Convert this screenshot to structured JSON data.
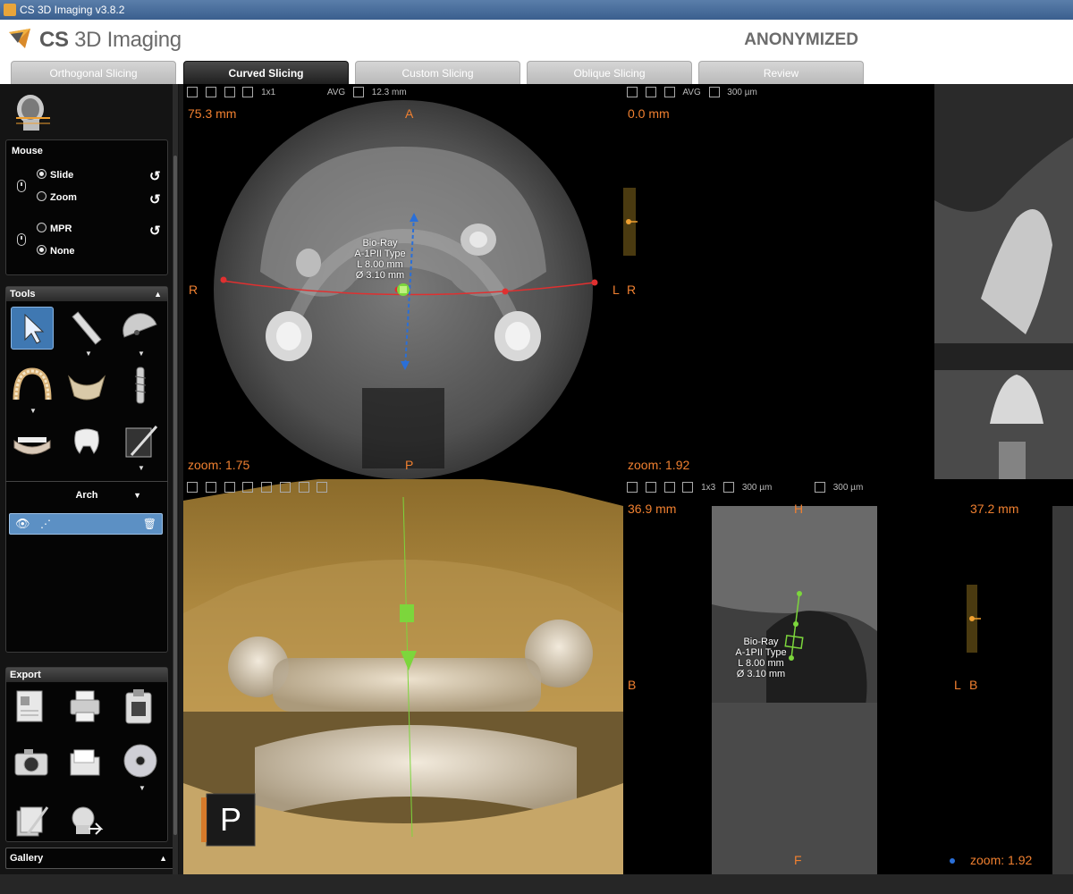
{
  "window": {
    "title": "CS 3D Imaging v3.8.2"
  },
  "header": {
    "brand_prefix": "CS",
    "brand_suffix": "3D Imaging",
    "patient": "ANONYMIZED"
  },
  "tabs": [
    {
      "label": "Orthogonal Slicing",
      "active": false
    },
    {
      "label": "Curved Slicing",
      "active": true
    },
    {
      "label": "Custom Slicing",
      "active": false
    },
    {
      "label": "Oblique Slicing",
      "active": false
    },
    {
      "label": "Review",
      "active": false
    }
  ],
  "left": {
    "mouse": {
      "title": "Mouse",
      "options": [
        "Slide",
        "Zoom",
        "MPR",
        "None"
      ],
      "selected": [
        "Slide",
        "None"
      ]
    },
    "tools": {
      "title": "Tools"
    },
    "arch": {
      "label": "Arch",
      "item_text": "⋰"
    },
    "export": {
      "title": "Export"
    },
    "gallery": {
      "label": "Gallery"
    }
  },
  "viewports": {
    "axial": {
      "toolbar": {
        "layout": "1x1",
        "mode": "AVG",
        "thickness": "12.3 mm"
      },
      "position": "75.3 mm",
      "orient": {
        "top": "A",
        "bottom": "P",
        "left": "R",
        "right": "L"
      },
      "implant": [
        "Bio-Ray",
        "A-1PII Type",
        "L 8.00 mm",
        "Ø 3.10 mm"
      ],
      "zoom": "zoom: 1.75"
    },
    "panoramic": {
      "toolbar": {
        "mode": "AVG",
        "thickness": "300 µm"
      },
      "position": "0.0 mm",
      "orient": {
        "left": "R"
      },
      "zoom": "zoom: 1.92"
    },
    "render3d": {
      "orient_badge": "P"
    },
    "cross": {
      "toolbar": {
        "layout": "1x3",
        "thickness": "300 µm",
        "thickness2": "300 µm"
      },
      "position": "36.9 mm",
      "position2": "37.2 mm",
      "orient": {
        "top": "H",
        "bottom": "F",
        "left": "B",
        "left2": "L",
        "left2b": "B"
      },
      "implant": [
        "Bio-Ray",
        "A-1PII Type",
        "L 8.00 mm",
        "Ø 3.10 mm"
      ],
      "zoom": "zoom: 1.92"
    }
  },
  "colors": {
    "accent": "#f08030",
    "selection": "#3f78b2",
    "implant": "#7cd63c",
    "arch_line": "#e03030",
    "axis": "#2a6fd8"
  }
}
